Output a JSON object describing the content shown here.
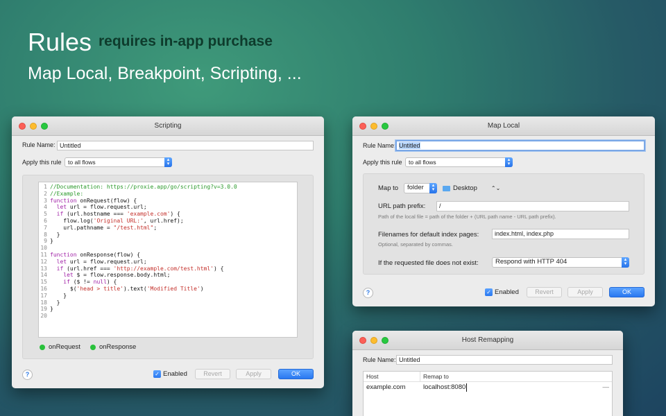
{
  "hero": {
    "title": "Rules",
    "badge": "requires in-app purchase",
    "subtitle": "Map Local, Breakpoint, Scripting, ..."
  },
  "scripting": {
    "title": "Scripting",
    "rule_name_label": "Rule Name:",
    "rule_name_value": "Untitled",
    "apply_label": "Apply this rule",
    "apply_value": "to all flows",
    "code_lines": [
      {
        "n": "1",
        "t": "//Documentation: https://proxie.app/go/scripting?v=3.0.0"
      },
      {
        "n": "2",
        "t": "//Example:"
      },
      {
        "n": "3",
        "kw": "function",
        "t": " onRequest(flow) {"
      },
      {
        "n": "4",
        "kw": "  let",
        "t": " url = flow.request.url;"
      },
      {
        "n": "5",
        "kw": "  if",
        "t": " (url.hostname === ",
        "s": "'example.com'",
        "t2": ") {"
      },
      {
        "n": "6",
        "t": "    flow.log(",
        "s": "'Original URL:'",
        "t2": ", url.href);"
      },
      {
        "n": "7",
        "t": "    url.pathname = ",
        "s": "\"/test.html\"",
        "t2": ";"
      },
      {
        "n": "8",
        "t": "  }"
      },
      {
        "n": "9",
        "t": "}"
      },
      {
        "n": "10",
        "t": ""
      },
      {
        "n": "11",
        "kw": "function",
        "t": " onResponse(flow) {"
      },
      {
        "n": "12",
        "kw": "  let",
        "t": " url = flow.request.url;"
      },
      {
        "n": "13",
        "kw": "  if",
        "t": " (url.href === ",
        "s": "'http://example.com/test.html'",
        "t2": ") {"
      },
      {
        "n": "14",
        "kw": "    let",
        "t": " $ = flow.response.body.html;"
      },
      {
        "n": "15",
        "kw": "    if",
        "t": " ($ != ",
        "k2": "null",
        "t2": ") {"
      },
      {
        "n": "16",
        "t": "      $(",
        "s": "'head > title'",
        "t2": ").text(",
        "s2": "'Modified Title'",
        "t3": ")"
      },
      {
        "n": "17",
        "t": "    }"
      },
      {
        "n": "18",
        "t": "  }"
      },
      {
        "n": "19",
        "t": "}"
      },
      {
        "n": "20",
        "t": ""
      }
    ],
    "on_request": "onRequest",
    "on_response": "onResponse",
    "enabled_label": "Enabled",
    "revert": "Revert",
    "apply": "Apply",
    "ok": "OK",
    "help": "?"
  },
  "map_local": {
    "title": "Map Local",
    "rule_name_label": "Rule Name:",
    "rule_name_value": "Untitled",
    "apply_label": "Apply this rule",
    "apply_value": "to all flows",
    "map_to_label": "Map to",
    "map_to_value": "folder",
    "folder_name": "Desktop",
    "url_prefix_label": "URL path prefix:",
    "url_prefix_value": "/",
    "url_prefix_hint": "Path of the local file = path of the folder + (URL path name - URL path prefix).",
    "index_label": "Filenames for default index pages:",
    "index_value": "index.html, index.php",
    "index_hint": "Optional, separated by commas.",
    "missing_label": "If the requested file does not exist:",
    "missing_value": "Respond with HTTP 404",
    "enabled_label": "Enabled",
    "revert": "Revert",
    "apply": "Apply",
    "ok": "OK",
    "help": "?"
  },
  "host_remapping": {
    "title": "Host Remapping",
    "rule_name_label": "Rule Name:",
    "rule_name_value": "Untitled",
    "columns": [
      "Host",
      "Remap to"
    ],
    "rows": [
      {
        "host": "example.com",
        "remap": "localhost:8080",
        "action": "—"
      }
    ]
  },
  "colors": {
    "accent": "#2a78f0",
    "traffic_red": "#fc5f57",
    "traffic_yellow": "#fdbc2e",
    "traffic_green": "#28c840",
    "status_green": "#29c13b"
  }
}
